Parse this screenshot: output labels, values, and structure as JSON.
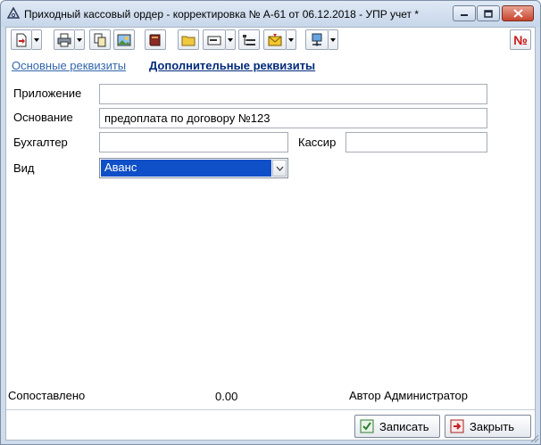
{
  "window": {
    "title": "Приходный кассовый ордер - корректировка № А-61 от 06.12.2018 - УПР учет *"
  },
  "toolbar": {
    "buttons": [
      {
        "name": "new-document-icon"
      },
      {
        "name": "print-icon"
      },
      {
        "name": "copy-icon"
      },
      {
        "name": "image-icon"
      },
      {
        "name": "book-icon"
      },
      {
        "name": "folder-icon"
      },
      {
        "name": "envelope-card-icon"
      },
      {
        "name": "structure-icon"
      },
      {
        "name": "mail-icon"
      },
      {
        "name": "network-icon"
      },
      {
        "name": "number-icon",
        "label": "№"
      }
    ]
  },
  "tabs": [
    {
      "label": "Основные реквизиты"
    },
    {
      "label": "Дополнительные реквизиты"
    }
  ],
  "form": {
    "attachment_label": "Приложение",
    "attachment_value": "",
    "basis_label": "Основание",
    "basis_value": "предоплата по договору №123",
    "accountant_label": "Бухгалтер",
    "accountant_value": "",
    "cashier_label": "Кассир",
    "cashier_value": "",
    "kind_label": "Вид",
    "kind_value": "Аванс"
  },
  "status": {
    "matched_label": "Сопоставлено",
    "amount": "0.00",
    "author": "Автор Администратор"
  },
  "buttons": {
    "save": "Записать",
    "close": "Закрыть"
  }
}
